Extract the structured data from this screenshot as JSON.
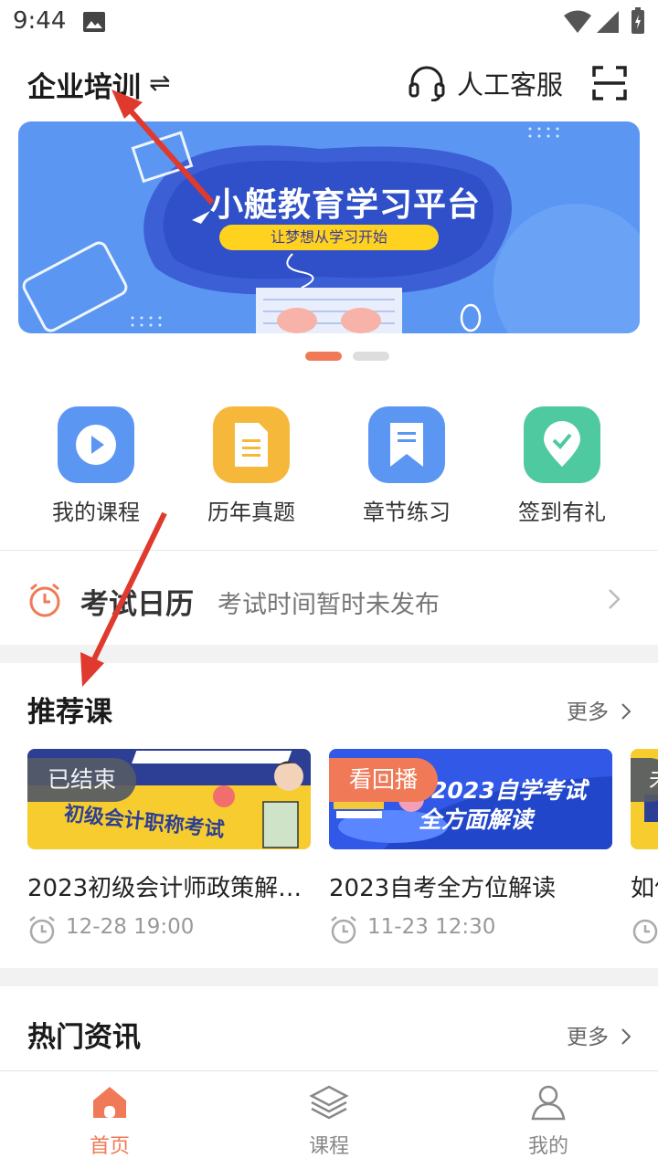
{
  "status_bar": {
    "time": "9:44"
  },
  "header": {
    "title": "企业培训",
    "swap_glyph": "⇌",
    "service_label": "人工客服",
    "icons": [
      "headset-icon",
      "scan-icon"
    ]
  },
  "banner": {
    "title": "小艇教育学习平台",
    "slogan": "让梦想从学习开始",
    "active_page": 1,
    "page_count": 2
  },
  "quick_entries": [
    {
      "label": "我的课程",
      "icon": "play-icon",
      "color": "#5b97f2"
    },
    {
      "label": "历年真题",
      "icon": "document-icon",
      "color": "#f5b83a"
    },
    {
      "label": "章节练习",
      "icon": "bookmark-icon",
      "color": "#5b97f2"
    },
    {
      "label": "签到有礼",
      "icon": "checkin-icon",
      "color": "#4fc9a0"
    }
  ],
  "exam_calendar": {
    "title": "考试日历",
    "description": "考试时间暂时未发布"
  },
  "recommended": {
    "title": "推荐课",
    "more": "更多",
    "courses": [
      {
        "badge": "已结束",
        "badge_color": "#555b66",
        "title": "2023初级会计师政策解…",
        "time": "12-28 19:00",
        "thumb_text": "初级会计职称考试"
      },
      {
        "badge": "看回播",
        "badge_color": "#f07a57",
        "title": "2023自考全方位解读",
        "time": "11-23 12:30",
        "thumb_text_1": "2023自学考试",
        "thumb_text_2": "全方面解读"
      },
      {
        "badge": "未",
        "badge_color": "#555b66",
        "title": "如何",
        "time": ""
      }
    ]
  },
  "hot_news": {
    "title": "热门资讯",
    "more": "更多"
  },
  "bottom_nav": {
    "items": [
      {
        "label": "首页",
        "icon": "home-icon",
        "active": true
      },
      {
        "label": "课程",
        "icon": "layers-icon",
        "active": false
      },
      {
        "label": "我的",
        "icon": "user-icon",
        "active": false
      }
    ],
    "active_color": "#f07a57",
    "inactive_color": "#888888"
  }
}
